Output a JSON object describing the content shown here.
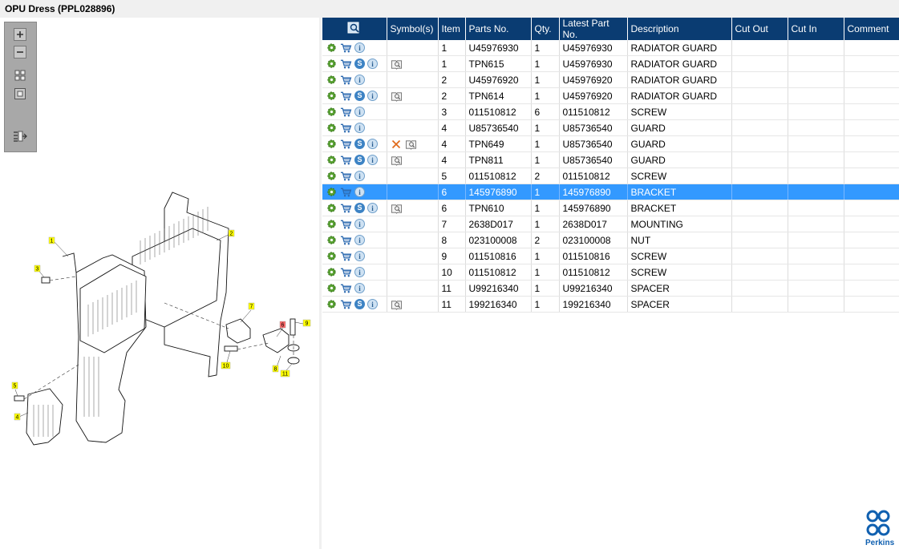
{
  "window": {
    "title": "OPU Dress (PPL028896)"
  },
  "toolbar": {
    "tools": [
      "zoom-in-icon",
      "zoom-out-icon",
      "fit-all-icon",
      "actual-size-icon",
      "toggle-list-icon"
    ]
  },
  "grid": {
    "columns": [
      "",
      "Symbol(s)",
      "Item",
      "Parts No.",
      "Qty.",
      "Latest Part No.",
      "Description",
      "Cut Out",
      "Cut In",
      "Comment"
    ],
    "rows": [
      {
        "item": "1",
        "part": "U45976930",
        "qty": "1",
        "latest": "U45976930",
        "desc": "RADIATOR GUARD",
        "s": false,
        "sym": "",
        "sel": false
      },
      {
        "item": "1",
        "part": "TPN615",
        "qty": "1",
        "latest": "U45976930",
        "desc": "RADIATOR GUARD",
        "s": true,
        "sym": "book",
        "sel": false
      },
      {
        "item": "2",
        "part": "U45976920",
        "qty": "1",
        "latest": "U45976920",
        "desc": "RADIATOR GUARD",
        "s": false,
        "sym": "",
        "sel": false
      },
      {
        "item": "2",
        "part": "TPN614",
        "qty": "1",
        "latest": "U45976920",
        "desc": "RADIATOR GUARD",
        "s": true,
        "sym": "book",
        "sel": false
      },
      {
        "item": "3",
        "part": "011510812",
        "qty": "6",
        "latest": "011510812",
        "desc": "SCREW",
        "s": false,
        "sym": "",
        "sel": false
      },
      {
        "item": "4",
        "part": "U85736540",
        "qty": "1",
        "latest": "U85736540",
        "desc": "GUARD",
        "s": false,
        "sym": "",
        "sel": false
      },
      {
        "item": "4",
        "part": "TPN649",
        "qty": "1",
        "latest": "U85736540",
        "desc": "GUARD",
        "s": true,
        "sym": "xbook",
        "sel": false
      },
      {
        "item": "4",
        "part": "TPN811",
        "qty": "1",
        "latest": "U85736540",
        "desc": "GUARD",
        "s": true,
        "sym": "book",
        "sel": false
      },
      {
        "item": "5",
        "part": "011510812",
        "qty": "2",
        "latest": "011510812",
        "desc": "SCREW",
        "s": false,
        "sym": "",
        "sel": false
      },
      {
        "item": "6",
        "part": "145976890",
        "qty": "1",
        "latest": "145976890",
        "desc": "BRACKET",
        "s": false,
        "sym": "",
        "sel": true
      },
      {
        "item": "6",
        "part": "TPN610",
        "qty": "1",
        "latest": "145976890",
        "desc": "BRACKET",
        "s": true,
        "sym": "book",
        "sel": false
      },
      {
        "item": "7",
        "part": "2638D017",
        "qty": "1",
        "latest": "2638D017",
        "desc": "MOUNTING",
        "s": false,
        "sym": "",
        "sel": false
      },
      {
        "item": "8",
        "part": "023100008",
        "qty": "2",
        "latest": "023100008",
        "desc": "NUT",
        "s": false,
        "sym": "",
        "sel": false
      },
      {
        "item": "9",
        "part": "011510816",
        "qty": "1",
        "latest": "011510816",
        "desc": "SCREW",
        "s": false,
        "sym": "",
        "sel": false
      },
      {
        "item": "10",
        "part": "011510812",
        "qty": "1",
        "latest": "011510812",
        "desc": "SCREW",
        "s": false,
        "sym": "",
        "sel": false
      },
      {
        "item": "11",
        "part": "U99216340",
        "qty": "1",
        "latest": "U99216340",
        "desc": "SPACER",
        "s": false,
        "sym": "",
        "sel": false
      },
      {
        "item": "11",
        "part": "199216340",
        "qty": "1",
        "latest": "199216340",
        "desc": "SPACER",
        "s": true,
        "sym": "book",
        "sel": false
      }
    ]
  },
  "diagram": {
    "callouts": [
      "1",
      "2",
      "3",
      "4",
      "5",
      "6",
      "7",
      "8",
      "9",
      "10",
      "11"
    ]
  },
  "brand": {
    "name": "Perkins",
    "color": "#1060b0"
  },
  "colors": {
    "header": "#0a3c72",
    "selection": "#3399ff",
    "callout_bg": "#ffff00",
    "callout_selected": "#ff6a6a"
  }
}
